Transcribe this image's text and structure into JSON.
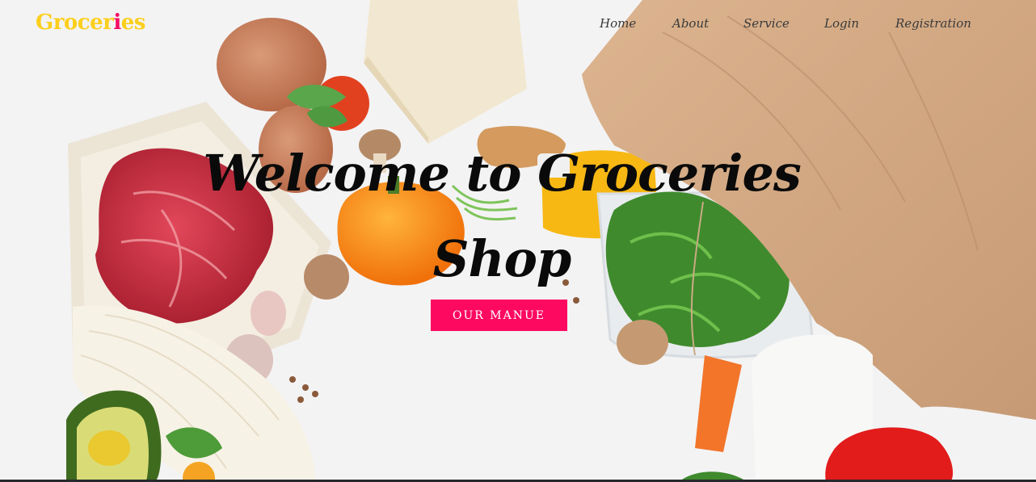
{
  "brand": {
    "name_prefix": "Grocer",
    "name_accent": "i",
    "name_suffix": "es"
  },
  "nav": {
    "items": [
      {
        "label": "Home"
      },
      {
        "label": "About"
      },
      {
        "label": "Service"
      },
      {
        "label": "Login"
      },
      {
        "label": "Registration"
      }
    ]
  },
  "hero": {
    "title": "Welcome to Groceries Shop",
    "cta_label": "OUR MANUE",
    "background_image": "groceries-flatlay"
  },
  "colors": {
    "brand_yellow": "#fccf1c",
    "accent_pink": "#fd0a60",
    "nav_text": "#3a3a3a",
    "title_text": "#0a0a0a"
  }
}
